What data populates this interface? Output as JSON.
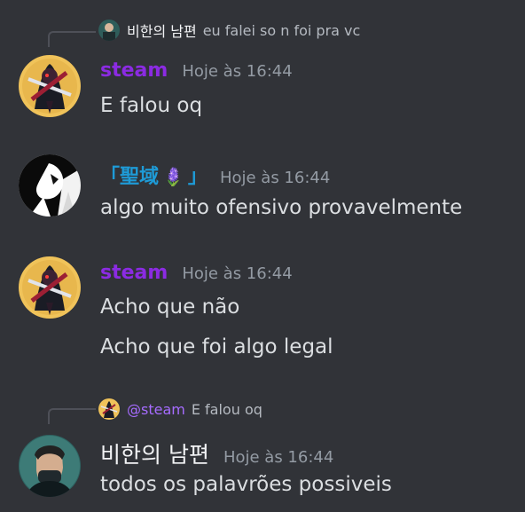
{
  "messages": [
    {
      "reply": {
        "author": "비한의 남편",
        "text": "eu falei so n foi pra vc"
      },
      "author": "steam",
      "timestamp": "Hoje às 16:44",
      "lines": [
        "E falou oq"
      ]
    },
    {
      "author_prefix": "「聖域",
      "author_emoji": "🪻",
      "author_suffix": "」",
      "timestamp": "Hoje às 16:44",
      "lines": [
        "algo muito ofensivo provavelmente"
      ]
    },
    {
      "author": "steam",
      "timestamp": "Hoje às 16:44",
      "lines": [
        "Acho que não",
        "Acho que foi algo legal"
      ]
    },
    {
      "reply": {
        "author": "@steam",
        "text": "E falou oq"
      },
      "author": "비한의 남편",
      "timestamp": "Hoje às 16:44",
      "lines": [
        "todos os palavrões possiveis"
      ]
    }
  ],
  "colors": {
    "background": "#313338",
    "steam_name": "#8b2be2",
    "holy_name": "#1e9bd7",
    "timestamp": "#949ba4",
    "text": "#dbdee1"
  }
}
